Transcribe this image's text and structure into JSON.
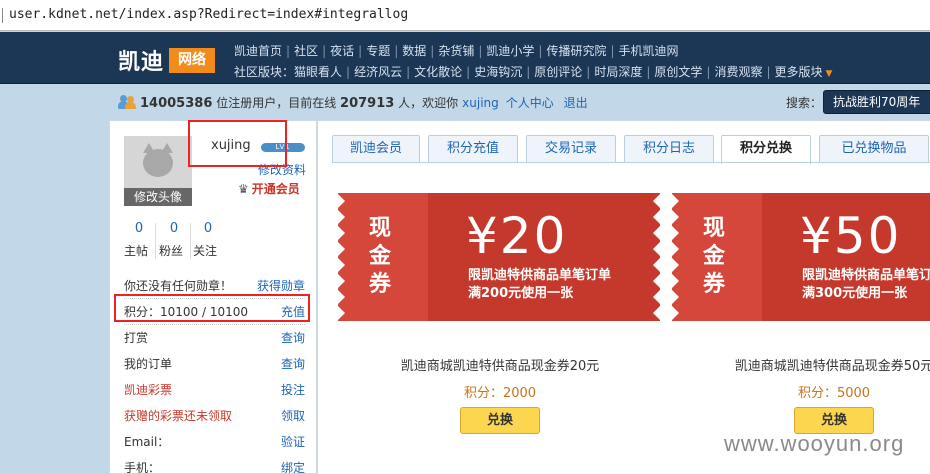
{
  "browser": {
    "url": "user.kdnet.net/index.asp?Redirect=index#integrallog"
  },
  "header": {
    "logo_text": "凯迪",
    "logo_badge": "网络",
    "nav_main": [
      "凯迪首页",
      "社区",
      "夜话",
      "专题",
      "数据",
      "杂货铺",
      "凯迪小学",
      "传播研究院",
      "手机凯迪网"
    ],
    "nav_sub_label": "社区版块：",
    "nav_sub": [
      "猫眼看人",
      "经济风云",
      "文化散论",
      "史海钩沉",
      "原创评论",
      "时局深度",
      "原创文学",
      "消费观察",
      "更多版块"
    ]
  },
  "status": {
    "registered": "14005386",
    "registered_label": "位注册用户，目前在线",
    "online": "207913",
    "online_label": "人，欢迎你",
    "user": "xujing",
    "user_center": "个人中心",
    "logout": "退出",
    "search_label": "搜索：",
    "search_value": "抗战胜利70周年"
  },
  "profile": {
    "avatar_caption": "修改头像",
    "username": "xujing",
    "level_badge": "LV1",
    "edit_profile": "修改资料",
    "open_member": "开通会员",
    "stats": [
      {
        "num": "0",
        "label": "主帖"
      },
      {
        "num": "0",
        "label": "粉丝"
      },
      {
        "num": "0",
        "label": "关注"
      }
    ],
    "menu": [
      {
        "key": "你还没有任何勋章！",
        "action": "获得勋章",
        "red": false
      },
      {
        "key": "积分：10100 / 10100",
        "action": "充值",
        "red": false
      },
      {
        "key": "打赏",
        "action": "查询",
        "red": false
      },
      {
        "key": "我的订单",
        "action": "查询",
        "red": false
      },
      {
        "key": "凯迪彩票",
        "action": "投注",
        "red": true
      },
      {
        "key": "获赠的彩票还未领取",
        "action": "领取",
        "red": true
      },
      {
        "key": "Email：",
        "action": "验证",
        "red": false
      },
      {
        "key": "手机：",
        "action": "绑定",
        "red": false
      }
    ]
  },
  "tabs": [
    "凯迪会员",
    "积分充值",
    "交易记录",
    "积分日志",
    "积分兑换",
    "已兑换物品"
  ],
  "active_tab": "积分兑换",
  "coupons": [
    {
      "stub": "现金券",
      "price": "¥20",
      "desc_line1": "限凯迪特供商品单笔订单",
      "desc_line2": "满200元使用一张",
      "name": "凯迪商城凯迪特供商品现金券20元",
      "points": "积分：2000",
      "button": "兑换"
    },
    {
      "stub": "现金券",
      "price": "¥50",
      "desc_line1": "限凯迪特供商品单笔订单",
      "desc_line2": "满300元使用一张",
      "name": "凯迪商城凯迪特供商品现金券50元",
      "points": "积分：5000",
      "button": "兑换"
    }
  ],
  "watermark": "www.wooyun.org",
  "colors": {
    "header_bg": "#1c3656",
    "accent_orange": "#f08b1c",
    "coupon_red": "#c5392d",
    "link_blue": "#1d64b4"
  }
}
